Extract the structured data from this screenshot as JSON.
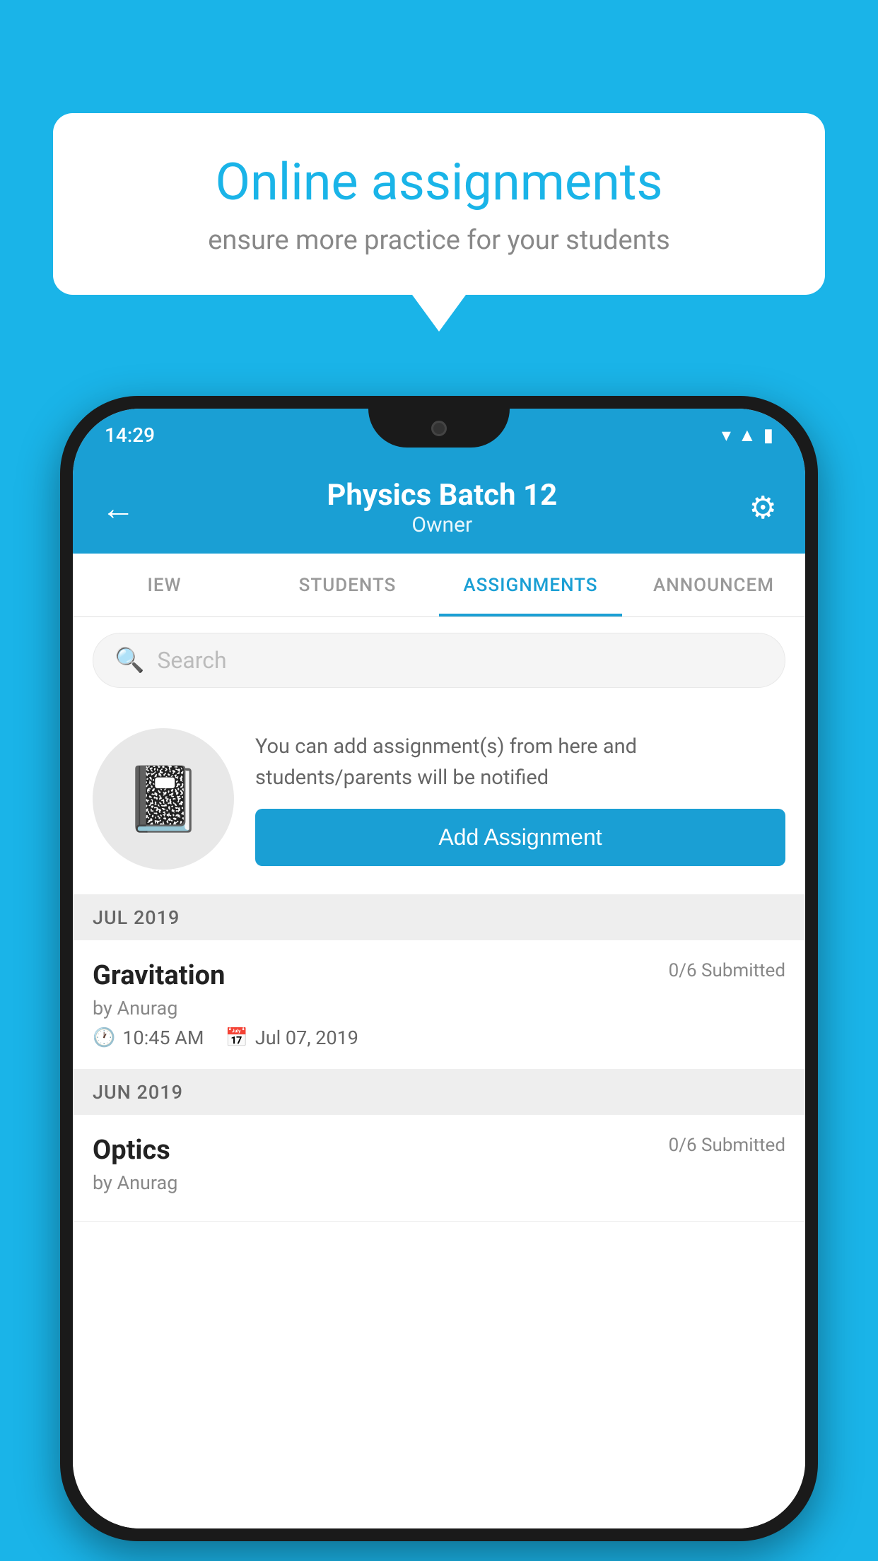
{
  "background_color": "#1ab4e8",
  "speech_bubble": {
    "title": "Online assignments",
    "subtitle": "ensure more practice for your students"
  },
  "phone": {
    "status_bar": {
      "time": "14:29",
      "icons": [
        "wifi",
        "signal",
        "battery"
      ]
    },
    "header": {
      "title": "Physics Batch 12",
      "subtitle": "Owner",
      "back_label": "←",
      "settings_label": "⚙"
    },
    "tabs": [
      {
        "label": "IEW",
        "active": false
      },
      {
        "label": "STUDENTS",
        "active": false
      },
      {
        "label": "ASSIGNMENTS",
        "active": true
      },
      {
        "label": "ANNOUNCEM",
        "active": false
      }
    ],
    "search": {
      "placeholder": "Search"
    },
    "promo": {
      "description": "You can add assignment(s) from here and students/parents will be notified",
      "button_label": "Add Assignment"
    },
    "sections": [
      {
        "month": "JUL 2019",
        "assignments": [
          {
            "name": "Gravitation",
            "submitted": "0/6 Submitted",
            "by": "by Anurag",
            "time": "10:45 AM",
            "date": "Jul 07, 2019"
          }
        ]
      },
      {
        "month": "JUN 2019",
        "assignments": [
          {
            "name": "Optics",
            "submitted": "0/6 Submitted",
            "by": "by Anurag",
            "time": "",
            "date": ""
          }
        ]
      }
    ]
  }
}
